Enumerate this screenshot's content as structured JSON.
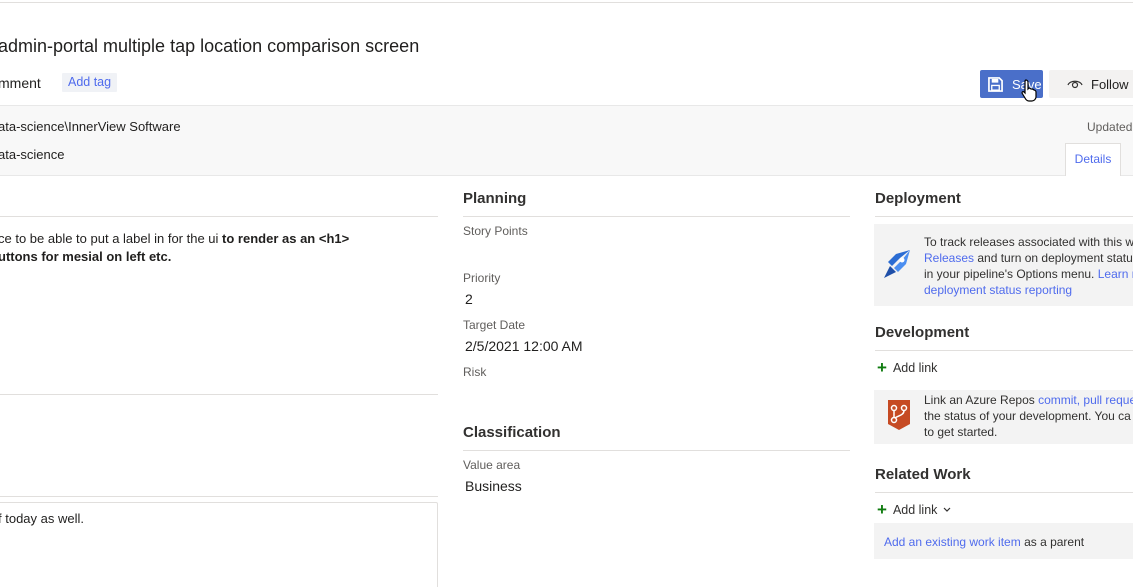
{
  "header": {
    "title": "admin-portal multiple tap location comparison screen",
    "comment_label": "mment",
    "add_tag_label": "Add tag",
    "save_label": "Save",
    "follow_label": "Follow"
  },
  "meta": {
    "area_path": "ata-science\\InnerView Software",
    "iteration": "ata-science",
    "updated_text": "Updated",
    "details_tab": "Details"
  },
  "description": {
    "line1_plain": "ce to be able to put a label in for the ui ",
    "line1_bold": "to render as an <h1>",
    "line2_bold": "uttons for mesial on left etc."
  },
  "discussion": {
    "text": "f today as well."
  },
  "planning": {
    "heading": "Planning",
    "story_points_label": "Story Points",
    "story_points_value": "",
    "priority_label": "Priority",
    "priority_value": "2",
    "target_date_label": "Target Date",
    "target_date_value": "2/5/2021 12:00 AM",
    "risk_label": "Risk",
    "risk_value": ""
  },
  "classification": {
    "heading": "Classification",
    "value_area_label": "Value area",
    "value_area_value": "Business"
  },
  "deployment": {
    "heading": "Deployment",
    "line1": "To track releases associated with this wo",
    "line2_link": "Releases",
    "line2_rest": " and turn on deployment status",
    "line3_plain": "in your pipeline's Options menu. ",
    "line3_link": "Learn m",
    "line4_link": "deployment status reporting"
  },
  "development": {
    "heading": "Development",
    "add_link_label": "Add link",
    "line1_plain": "Link an Azure Repos ",
    "line1_link": "commit, pull reque",
    "line2": "the status of your development. You ca",
    "line3": "to get started."
  },
  "related_work": {
    "heading": "Related Work",
    "add_link_label": "Add link",
    "existing_link": "Add an existing work item",
    "existing_suffix": " as a parent"
  },
  "colors": {
    "accent": "#4f6bed",
    "save_button": "#4a6fc9",
    "add_green": "#107c10"
  },
  "icons": [
    "save-icon",
    "eye-icon",
    "cursor-icon",
    "rocket-icon",
    "repo-icon",
    "plus-icon",
    "chevron-down-icon"
  ]
}
